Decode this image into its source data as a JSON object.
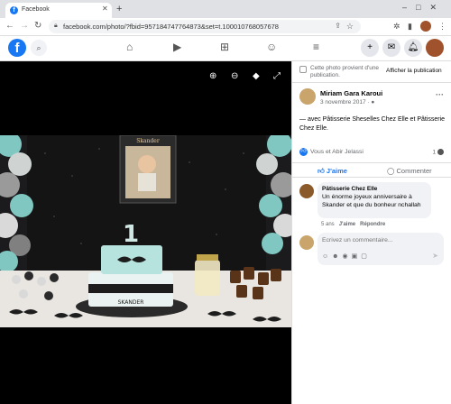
{
  "browser": {
    "tab_title": "Facebook",
    "favicon": "f",
    "new_tab": "+",
    "url": "facebook.com/photo/?fbid=957184747764873&set=t.100010768057678"
  },
  "fb_header": {
    "logo": "f",
    "nav_icons": [
      "home-icon",
      "watch-icon",
      "marketplace-icon",
      "groups-icon",
      "menu-icon"
    ],
    "right_icons": [
      "add-icon",
      "messenger-icon",
      "notifications-icon",
      "profile-avatar"
    ]
  },
  "photo_toolbar": {
    "icons": [
      "zoom-in-icon",
      "zoom-out-icon",
      "tag-icon",
      "fullscreen-icon"
    ]
  },
  "photo": {
    "poster_name": "Skander",
    "cake_number": "1",
    "cake_label": "SKANDER"
  },
  "notice": {
    "text": "Cette photo provient d'une publication.",
    "link": "Afficher la publication"
  },
  "post": {
    "author": "Miriam Gara Karoui",
    "date": "3 novembre 2017 · ",
    "caption": "— avec Pâtisserie Sheselles Chez Elle et Pâtisserie Chez Elle.",
    "reactions_text": "Vous et Abir Jelassi",
    "reactions_count": "1",
    "like_label": "J'aime",
    "comment_label": "Commenter"
  },
  "comment": {
    "author": "Pâtisserie Chez Elle",
    "text": "Un énorme joyeux anniversaire à Skander et que du bonheur nchallah",
    "meta_time": "5 ans",
    "meta_like": "J'aime",
    "meta_reply": "Répondre"
  },
  "write_comment": {
    "placeholder": "Écrivez un commentaire..."
  },
  "colors": {
    "fb_blue": "#1877f2",
    "photo_bg": "#000000",
    "comment_bg": "#f0f2f5"
  }
}
